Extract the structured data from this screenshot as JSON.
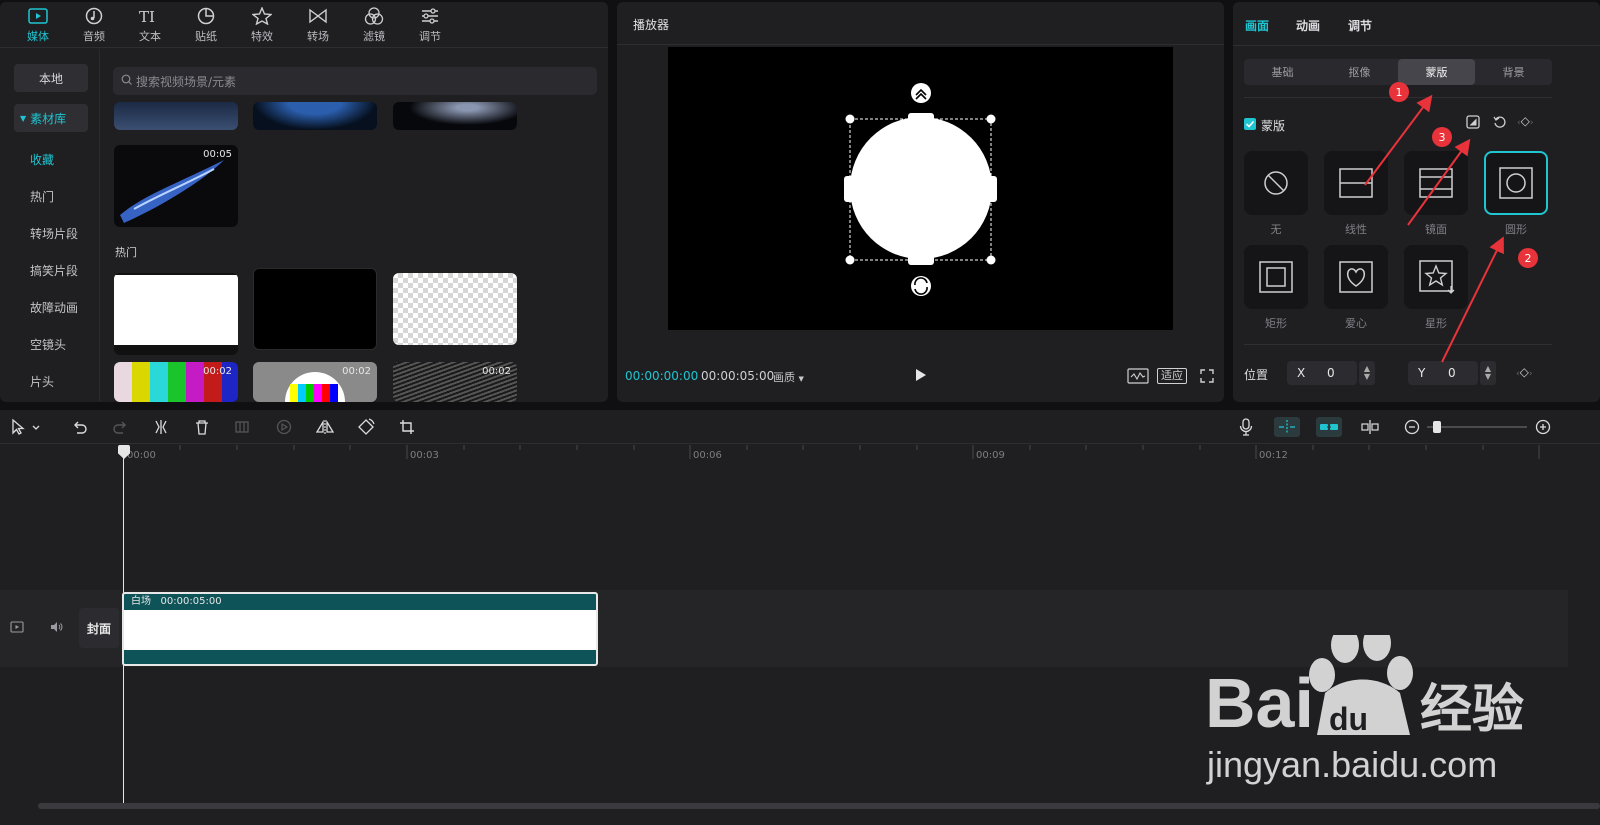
{
  "media": {
    "nav": [
      {
        "label": "媒体",
        "icon": "media-icon"
      },
      {
        "label": "音频",
        "icon": "audio-icon"
      },
      {
        "label": "文本",
        "icon": "text-icon"
      },
      {
        "label": "贴纸",
        "icon": "sticker-icon"
      },
      {
        "label": "特效",
        "icon": "effects-icon"
      },
      {
        "label": "转场",
        "icon": "transition-icon"
      },
      {
        "label": "滤镜",
        "icon": "filter-icon"
      },
      {
        "label": "调节",
        "icon": "adjust-icon"
      }
    ],
    "sidebar": {
      "local": "本地",
      "library": "素材库",
      "items": [
        "收藏",
        "热门",
        "转场片段",
        "搞笑片段",
        "故障动画",
        "空镜头",
        "片头"
      ]
    },
    "search_placeholder": "搜索视频场景/元素",
    "section_hot": "热门",
    "durations": {
      "fav1": "00:05",
      "t4": "00:02",
      "t5": "00:02",
      "t6": "00:02"
    }
  },
  "player": {
    "title": "播放器",
    "current_time": "00:00:00:00",
    "total_time": "00:00:05:00",
    "quality": "画质",
    "fit": "适应"
  },
  "inspector": {
    "tabs": [
      "画面",
      "动画",
      "调节"
    ],
    "subtabs": [
      "基础",
      "抠像",
      "蒙版",
      "背景"
    ],
    "mask_label": "蒙版",
    "masks": [
      "无",
      "线性",
      "镜面",
      "圆形",
      "矩形",
      "爱心",
      "星形"
    ],
    "position_label": "位置",
    "x_label": "X",
    "x_value": "0",
    "y_label": "Y",
    "y_value": "0",
    "annotations": [
      "1",
      "2",
      "3"
    ]
  },
  "timeline": {
    "ruler": [
      "00:00",
      "00:03",
      "00:06",
      "00:09",
      "00:12"
    ],
    "clip_name": "白场",
    "clip_duration": "00:00:05:00",
    "cover_label": "封面"
  },
  "watermark": {
    "brand": "Baidu",
    "brand_cn": "经验",
    "url": "jingyan.baidu.com"
  },
  "colors": {
    "accent": "#1fc5d1",
    "clip": "#0d5358",
    "annotation": "#e8333a"
  }
}
